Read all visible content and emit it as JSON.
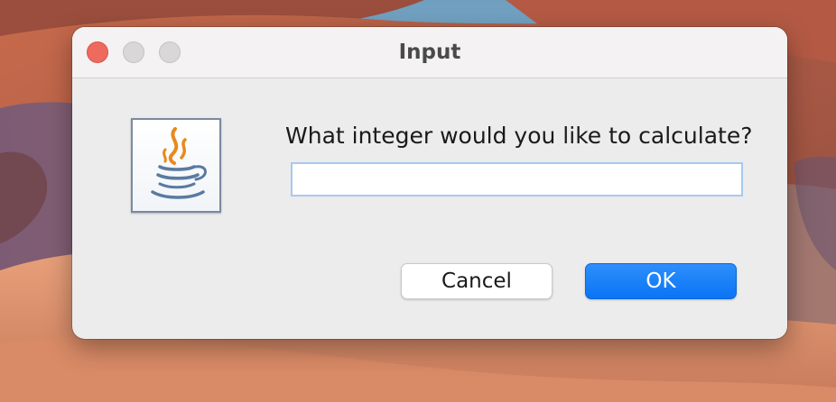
{
  "dialog": {
    "title": "Input",
    "message": "What integer would you like to calculate?",
    "input": {
      "value": "",
      "placeholder": ""
    },
    "buttons": {
      "cancel_label": "Cancel",
      "ok_label": "OK"
    },
    "icon": "java-coffee-cup-icon"
  },
  "window_controls": [
    "close-button",
    "minimize-button",
    "zoom-button"
  ],
  "colors": {
    "close": "#ee6a5f",
    "inactive_control": "#d9d7d8",
    "ok_button": "#0a74f5",
    "input_focus_border": "#a9c8f0",
    "java_orange": "#e8891c",
    "java_blue": "#5a7aa0"
  }
}
